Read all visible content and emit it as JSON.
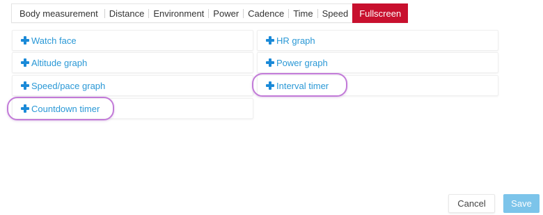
{
  "tabs": [
    {
      "label": "Body measurement"
    },
    {
      "label": "Distance"
    },
    {
      "label": "Environment"
    },
    {
      "label": "Power"
    },
    {
      "label": "Cadence"
    },
    {
      "label": "Time"
    },
    {
      "label": "Speed"
    },
    {
      "label": "Fullscreen",
      "active": true
    }
  ],
  "panels": [
    {
      "label": "Watch face",
      "icon": "plus-icon"
    },
    {
      "label": "HR graph",
      "icon": "plus-icon"
    },
    {
      "label": "Altitude graph",
      "icon": "plus-icon"
    },
    {
      "label": "Power graph",
      "icon": "plus-icon"
    },
    {
      "label": "Speed/pace graph",
      "icon": "plus-icon"
    },
    {
      "label": "Interval timer",
      "icon": "plus-icon",
      "highlighted": true
    },
    {
      "label": "Countdown timer",
      "icon": "plus-icon",
      "highlighted": true
    }
  ],
  "buttons": {
    "cancel": "Cancel",
    "save": "Save"
  },
  "colors": {
    "active_tab": "#c8102e",
    "link": "#2a98d6",
    "plus_icon": "#1b8ad8",
    "highlight": "#c27ad8",
    "save_button": "#7cc4ea"
  }
}
